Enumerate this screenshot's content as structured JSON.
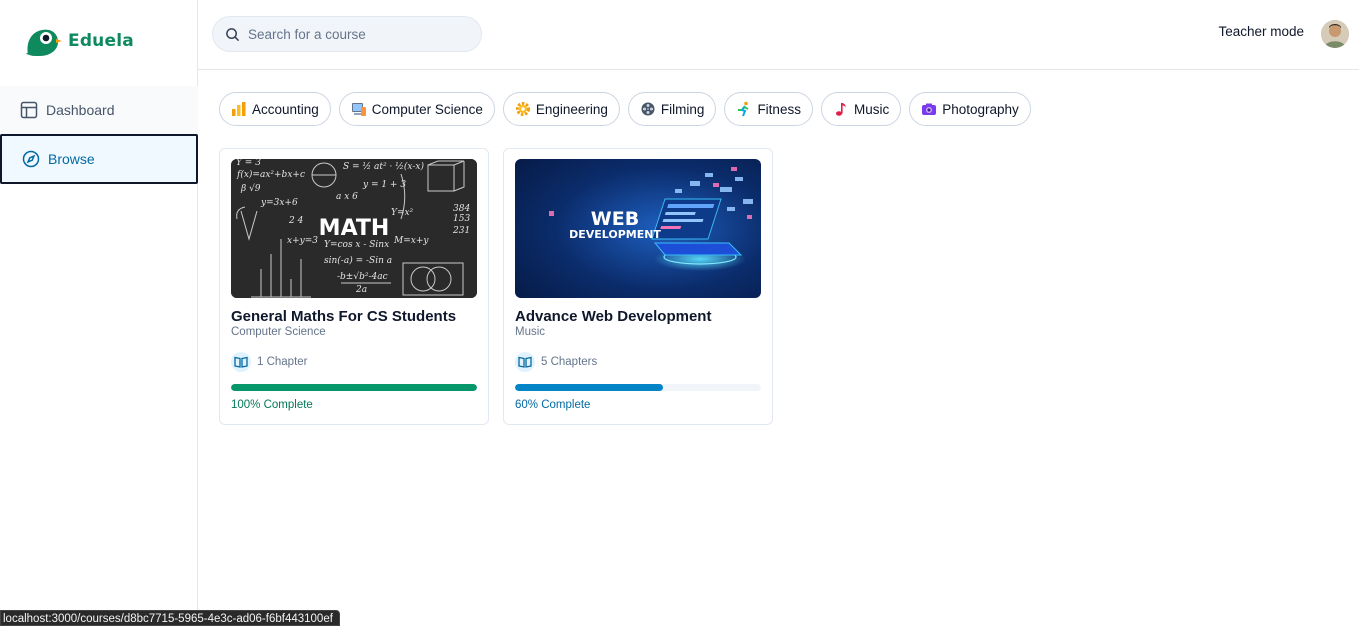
{
  "app": {
    "name": "Eduela",
    "brand_color": "#0f8a5f"
  },
  "sidebar": {
    "items": [
      {
        "label": "Dashboard",
        "icon": "layout-icon",
        "active": false
      },
      {
        "label": "Browse",
        "icon": "compass-icon",
        "active": true
      }
    ]
  },
  "header": {
    "search_placeholder": "Search for a course",
    "teacher_mode": "Teacher mode"
  },
  "categories": [
    {
      "label": "Accounting",
      "icon": "chart-icon"
    },
    {
      "label": "Computer Science",
      "icon": "computer-icon"
    },
    {
      "label": "Engineering",
      "icon": "gear-icon"
    },
    {
      "label": "Filming",
      "icon": "film-reel-icon"
    },
    {
      "label": "Fitness",
      "icon": "runner-icon"
    },
    {
      "label": "Music",
      "icon": "music-note-icon"
    },
    {
      "label": "Photography",
      "icon": "camera-icon"
    }
  ],
  "courses": [
    {
      "title": "General Maths For CS Students",
      "category": "Computer Science",
      "chapters": "1 Chapter",
      "progress": 100,
      "progress_label": "100% Complete",
      "progress_color": "#059669",
      "thumb_text": "MATH"
    },
    {
      "title": "Advance Web Development",
      "category": "Music",
      "chapters": "5 Chapters",
      "progress": 60,
      "progress_label": "60% Complete",
      "progress_color": "#0284c7",
      "thumb_text_1": "WEB",
      "thumb_text_2": "DEVELOPMENT"
    }
  ],
  "status_bar": {
    "url": "localhost:3000/courses/d8bc7715-5965-4e3c-ad06-f6bf443100ef"
  }
}
